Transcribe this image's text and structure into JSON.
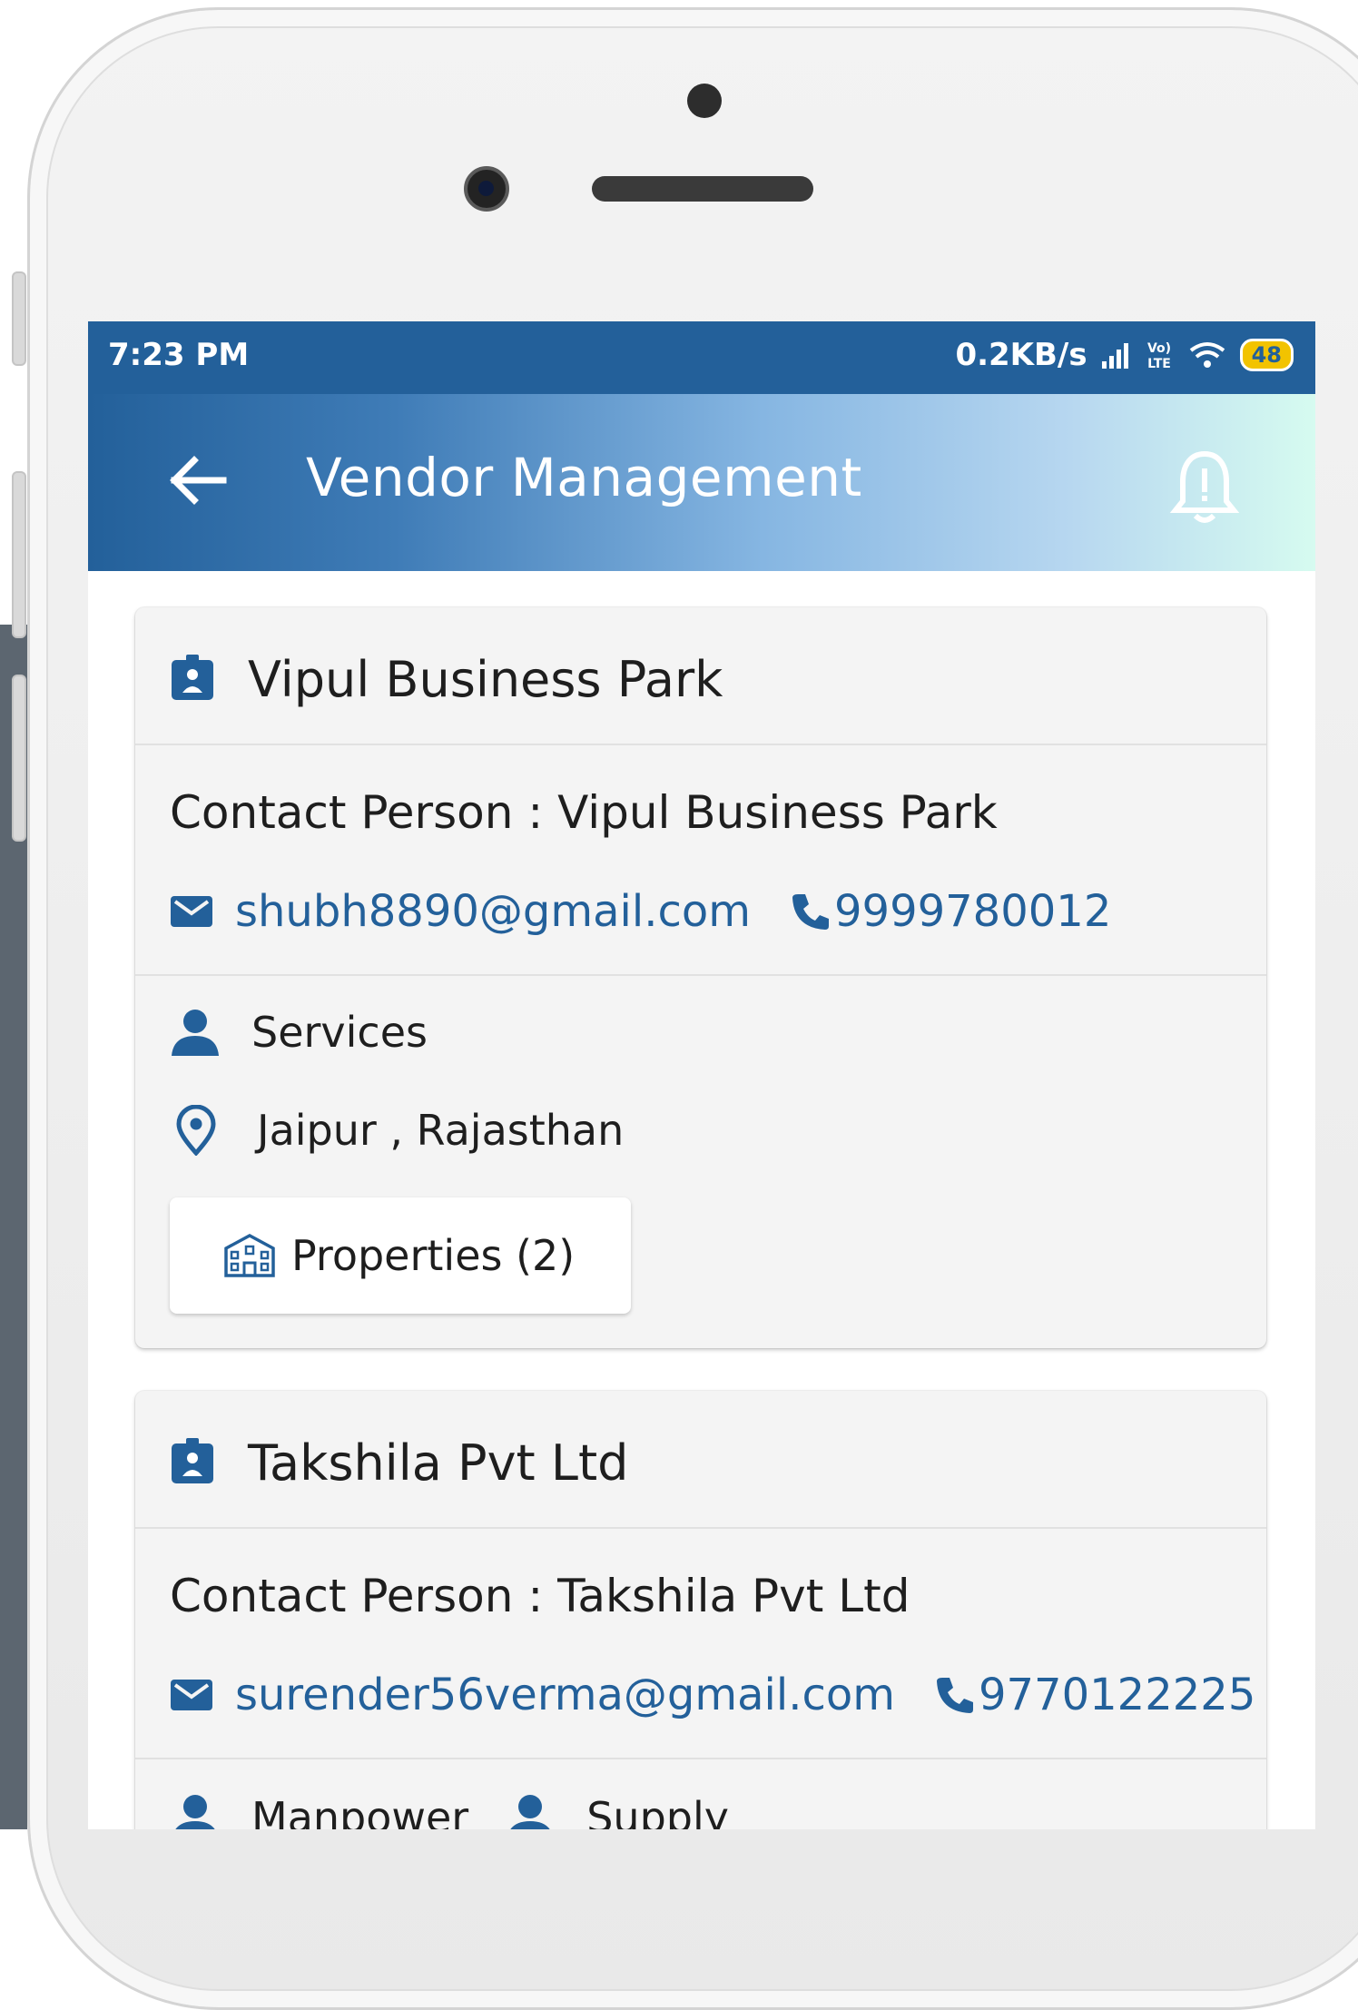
{
  "status_bar": {
    "time": "7:23 PM",
    "network_speed": "0.2KB/s",
    "volte": "Vo) LTE",
    "battery": "48"
  },
  "app_bar": {
    "title": "Vendor Management",
    "back_icon": "arrow-left-icon",
    "bell_icon": "bell-alert-icon"
  },
  "colors": {
    "primary": "#23609a",
    "gradient_end": "#d6fbf0",
    "card_bg": "#f4f4f4"
  },
  "vendors": [
    {
      "name": "Vipul Business Park",
      "contact_person_label": "Contact Person :",
      "contact_person": "Vipul Business Park",
      "email": "shubh8890@gmail.com",
      "phone": "9999780012",
      "services": [
        "Services"
      ],
      "location": "Jaipur , Rajasthan",
      "properties_button": "Properties (2)"
    },
    {
      "name": "Takshila Pvt Ltd",
      "contact_person_label": "Contact Person :",
      "contact_person": "Takshila Pvt Ltd",
      "email": "surender56verma@gmail.com",
      "phone": "9770122225",
      "services": [
        "Manpower",
        "Supply"
      ]
    }
  ]
}
